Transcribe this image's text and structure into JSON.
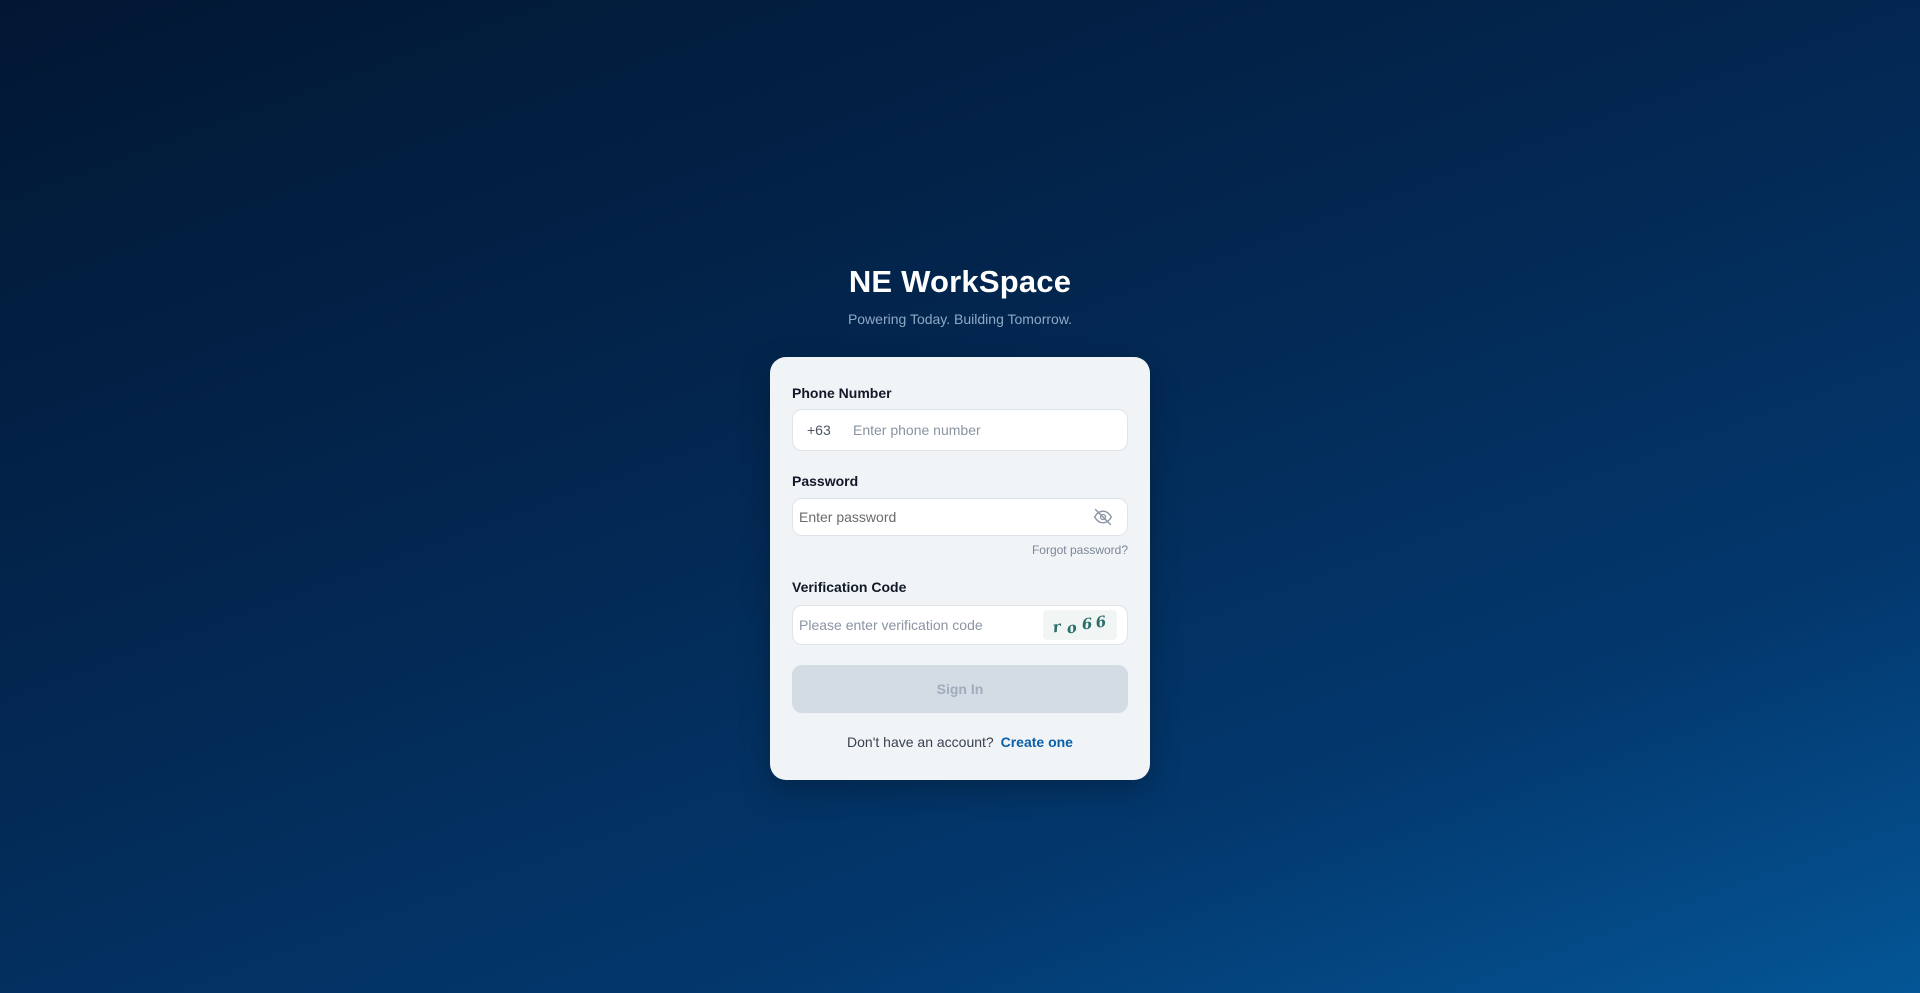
{
  "header": {
    "title": "NE WorkSpace",
    "tagline": "Powering Today. Building Tomorrow."
  },
  "form": {
    "phone": {
      "label": "Phone Number",
      "country_code": "+63",
      "placeholder": "Enter phone number",
      "value": ""
    },
    "password": {
      "label": "Password",
      "placeholder": "Enter password",
      "value": "",
      "toggle_icon": "eye-off-icon"
    },
    "forgot_link": "Forgot password?",
    "verification": {
      "label": "Verification Code",
      "placeholder": "Please enter verification code",
      "value": "",
      "captcha_text": "ro66"
    },
    "submit_label": "Sign In",
    "submit_enabled": false,
    "signup_prompt": "Don't have an account?",
    "signup_link": "Create one"
  },
  "colors": {
    "background_top": "#021733",
    "background_bottom": "#045696",
    "card": "#f1f4f7",
    "link": "#0a5fa8",
    "captcha_ink": "#2b6f6a"
  }
}
